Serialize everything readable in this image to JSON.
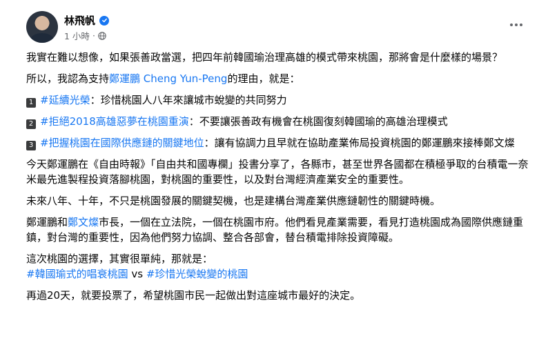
{
  "author": {
    "name": "林飛帆",
    "timestamp": "1 小時",
    "dot": "·"
  },
  "icons": {
    "verified": "verified-check-icon",
    "audience": "globe-icon",
    "more": "more-options-icon"
  },
  "colors": {
    "link": "#1877f2",
    "text": "#050505",
    "meta": "#65676b"
  },
  "post": {
    "p1": "我實在難以想像，如果張善政當選，把四年前韓國瑜治理高雄的模式帶來桃園，那將會是什麼樣的場景？",
    "p2_prefix": "所以，我認為支持",
    "p2_link": "鄭運鵬 Cheng Yun-Peng",
    "p2_suffix": "的理由，就是：",
    "reasons": [
      {
        "num": "1",
        "hashtag": "#延續光榮",
        "text": "：珍惜桃園人八年來讓城市蛻變的共同努力"
      },
      {
        "num": "2",
        "hashtag": "#拒絕2018高雄惡夢在桃園重演",
        "text": "：不要讓張善政有機會在桃園復刻韓國瑜的高雄治理模式"
      },
      {
        "num": "3",
        "hashtag": "#把握桃園在國際供應鏈的關鍵地位",
        "text": "：讓有協調力且早就在協助產業佈局投資桃園的鄭運鵬來接棒鄭文燦"
      }
    ],
    "p3": "今天鄭運鵬在《自由時報》「自由共和國專欄」投書分享了，各縣市，甚至世界各國都在積極爭取的台積電一奈米最先進製程投資落腳桃園，對桃園的重要性，以及對台灣經濟產業安全的重要性。",
    "p4": "未來八年、十年，不只是桃園發展的關鍵契機，也是建構台灣產業供應鏈韌性的關鍵時機。",
    "p5_prefix": "鄭運鵬和",
    "p5_link": "鄭文燦",
    "p5_suffix": "市長，一個在立法院，一個在桃園市府。他們看見產業需要，看見打造桃園成為國際供應鏈重鎮，對台灣的重要性，因為他們努力協調、整合各部會，替台積電排除投資障礙。",
    "p6": "這次桃園的選擇，其實很單純，那就是：",
    "p6_hashtag_a": "#韓國瑜式的唱衰桃園",
    "p6_vs": " vs ",
    "p6_hashtag_b": "#珍惜光榮蛻變的桃園",
    "p7": "再過20天，就要投票了，希望桃園市民一起做出對這座城市最好的決定。"
  }
}
